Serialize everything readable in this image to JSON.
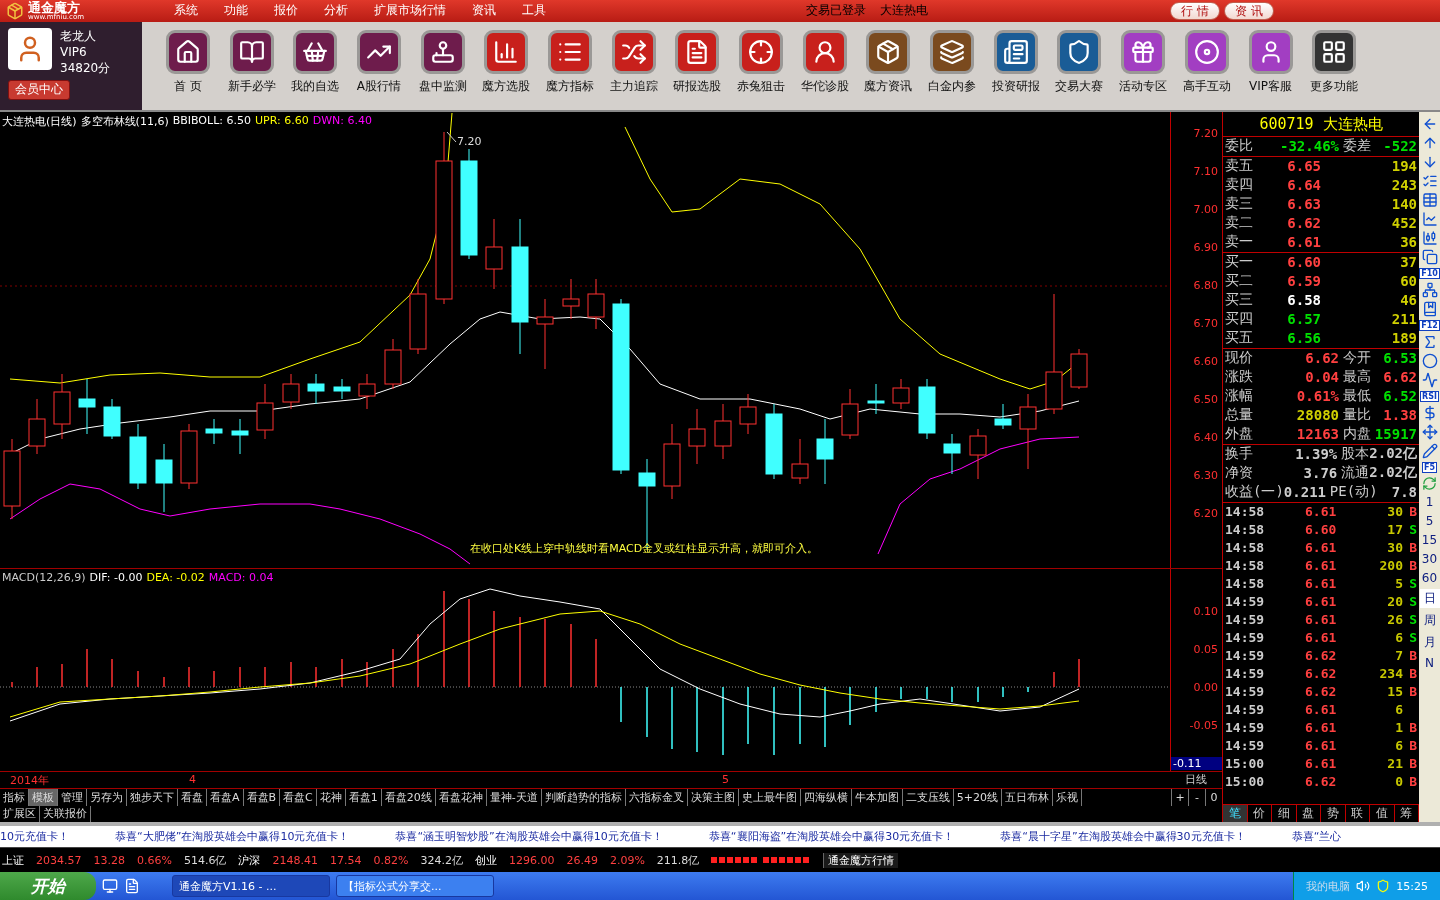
{
  "titlebar": {
    "logo": "通金魔方",
    "logo_url": "www.mfniu.com",
    "menu": [
      "系统",
      "功能",
      "报价",
      "分析",
      "扩展市场行情",
      "资讯",
      "工具"
    ],
    "login_status": "交易已登录",
    "stock": "大连热电",
    "tabs": [
      {
        "label": "行 情"
      },
      {
        "label": "资 讯"
      }
    ]
  },
  "user": {
    "name": "老龙人",
    "level": "VIP6",
    "points": "34820分",
    "button": "会员中心"
  },
  "toolbar": [
    {
      "label": "首 页",
      "color": "#6e1c4c"
    },
    {
      "label": "新手必学",
      "color": "#6e1c4c"
    },
    {
      "label": "我的自选",
      "color": "#6e1c4c"
    },
    {
      "label": "A股行情",
      "color": "#6e1c4c"
    },
    {
      "label": "盘中监测",
      "color": "#6e1c4c"
    },
    {
      "label": "魔方选股",
      "color": "#c8201c"
    },
    {
      "label": "魔方指标",
      "color": "#c8201c"
    },
    {
      "label": "主力追踪",
      "color": "#c8201c"
    },
    {
      "label": "研报选股",
      "color": "#c8201c"
    },
    {
      "label": "赤兔狙击",
      "color": "#c8201c"
    },
    {
      "label": "华佗诊股",
      "color": "#c8201c"
    },
    {
      "label": "魔方资讯",
      "color": "#7a4a1e"
    },
    {
      "label": "白金内参",
      "color": "#7a4a1e"
    },
    {
      "label": "投资研报",
      "color": "#1a5c96"
    },
    {
      "label": "交易大赛",
      "color": "#1a5c96"
    },
    {
      "label": "活动专区",
      "color": "#a23ec2"
    },
    {
      "label": "高手互动",
      "color": "#a23ec2"
    },
    {
      "label": "VIP客服",
      "color": "#a23ec2"
    },
    {
      "label": "更多功能",
      "color": "#333333"
    }
  ],
  "chart": {
    "title": "大连热电(日线)",
    "indicator": "多空布林线(11,6)",
    "values": [
      {
        "label": "BBIBOLL: 6.50",
        "color": "#ffffff"
      },
      {
        "label": "UPR: 6.60",
        "color": "#ffff00"
      },
      {
        "label": "DWN: 6.40",
        "color": "#ff00ff"
      }
    ],
    "peak_label": "7.20",
    "note": "在收口处K线上穿中轨线时看MACD金叉或红柱显示升高，就即可介入。",
    "price_ticks": [
      "7.20",
      "7.10",
      "7.00",
      "6.90",
      "6.80",
      "6.70",
      "6.60",
      "6.50",
      "6.40",
      "6.30",
      "6.20"
    ]
  },
  "macd": {
    "title": "MACD(12,26,9)",
    "values": [
      {
        "label": "DIF: -0.00",
        "color": "#ffffff"
      },
      {
        "label": "DEA: -0.02",
        "color": "#ffff00"
      },
      {
        "label": "MACD: 0.04",
        "color": "#ff00ff"
      }
    ],
    "ticks": [
      "0.10",
      "0.05",
      "0.00",
      "-0.05"
    ],
    "cursor_value": "-0.11"
  },
  "time_axis": {
    "year": "2014年",
    "months": [
      "4",
      "5"
    ],
    "period": "日线",
    "zoom_buttons": [
      "+",
      "-",
      "0"
    ]
  },
  "formula_tabs": [
    {
      "label": "指标",
      "selected": false
    },
    {
      "label": "模板",
      "selected": true
    },
    {
      "label": "管理",
      "selected": false
    },
    {
      "label": "另存为",
      "selected": false
    },
    {
      "label": "独步天下",
      "selected": false
    },
    {
      "label": "看盘",
      "selected": false
    },
    {
      "label": "看盘A",
      "selected": false
    },
    {
      "label": "看盘B",
      "selected": false
    },
    {
      "label": "看盘C",
      "selected": false
    },
    {
      "label": "花神",
      "selected": false
    },
    {
      "label": "看盘1",
      "selected": false
    },
    {
      "label": "看盘20线",
      "selected": false
    },
    {
      "label": "看盘花神",
      "selected": false
    },
    {
      "label": "量神-天道",
      "selected": false
    },
    {
      "label": "判断趋势的指标",
      "selected": false
    },
    {
      "label": "六指标金叉",
      "selected": false
    },
    {
      "label": "决策主图",
      "selected": false
    },
    {
      "label": "史上最牛图",
      "selected": false
    },
    {
      "label": "四海纵横",
      "selected": false
    },
    {
      "label": "牛本加图",
      "selected": false
    },
    {
      "label": "二支压线",
      "selected": false
    },
    {
      "label": "5+20线",
      "selected": false
    },
    {
      "label": "五日布林",
      "selected": false
    },
    {
      "label": "乐视",
      "selected": false
    }
  ],
  "extra_tabs": [
    "扩展区",
    "关联报价"
  ],
  "quote": {
    "title": "600719 大连热电",
    "ratio": [
      {
        "label": "委比",
        "value": "-32.46%"
      },
      {
        "label": "委差",
        "value": "-522"
      }
    ],
    "asks": [
      {
        "label": "卖五",
        "price": "6.65",
        "volume": "194",
        "color": "#ff4040"
      },
      {
        "label": "卖四",
        "price": "6.64",
        "volume": "243",
        "color": "#ff4040"
      },
      {
        "label": "卖三",
        "price": "6.63",
        "volume": "140",
        "color": "#ff4040"
      },
      {
        "label": "卖二",
        "price": "6.62",
        "volume": "452",
        "color": "#ff4040"
      },
      {
        "label": "卖一",
        "price": "6.61",
        "volume": "36",
        "color": "#ff4040"
      }
    ],
    "bids": [
      {
        "label": "买一",
        "price": "6.60",
        "volume": "37",
        "color": "#ff4040"
      },
      {
        "label": "买二",
        "price": "6.59",
        "volume": "60",
        "color": "#ff4040"
      },
      {
        "label": "买三",
        "price": "6.58",
        "volume": "46",
        "color": "#ffffff"
      },
      {
        "label": "买四",
        "price": "6.57",
        "volume": "211",
        "color": "#00e000"
      },
      {
        "label": "买五",
        "price": "6.56",
        "volume": "189",
        "color": "#00e000"
      }
    ],
    "stats": [
      [
        {
          "label": "现价",
          "value": "6.62",
          "color": "#ff4040"
        },
        {
          "label": "今开",
          "value": "6.53",
          "color": "#00e000"
        }
      ],
      [
        {
          "label": "涨跌",
          "value": "0.04",
          "color": "#ff4040"
        },
        {
          "label": "最高",
          "value": "6.62",
          "color": "#ff4040"
        }
      ],
      [
        {
          "label": "涨幅",
          "value": "0.61%",
          "color": "#ff4040"
        },
        {
          "label": "最低",
          "value": "6.52",
          "color": "#00e000"
        }
      ],
      [
        {
          "label": "总量",
          "value": "28080",
          "color": "#d0d000"
        },
        {
          "label": "量比",
          "value": "1.38",
          "color": "#ff4040"
        }
      ],
      [
        {
          "label": "外盘",
          "value": "12163",
          "color": "#ff4040"
        },
        {
          "label": "内盘",
          "value": "15917",
          "color": "#00e000"
        }
      ]
    ],
    "info": [
      [
        {
          "label": "换手",
          "value": "1.39%"
        },
        {
          "label": "股本",
          "value": "2.02亿"
        }
      ],
      [
        {
          "label": "净资",
          "value": "3.76"
        },
        {
          "label": "流通",
          "value": "2.02亿"
        }
      ],
      [
        {
          "label": "收益(一)",
          "value": "0.211"
        },
        {
          "label": "PE(动)",
          "value": "7.8"
        }
      ]
    ],
    "trades": [
      {
        "time": "14:58",
        "price": "6.61",
        "volume": "30",
        "side": "B",
        "color": "#ff4040"
      },
      {
        "time": "14:58",
        "price": "6.60",
        "volume": "17",
        "side": "S",
        "color": "#00e000"
      },
      {
        "time": "14:58",
        "price": "6.61",
        "volume": "30",
        "side": "B",
        "color": "#ff4040"
      },
      {
        "time": "14:58",
        "price": "6.61",
        "volume": "200",
        "side": "B",
        "color": "#ff4040"
      },
      {
        "time": "14:58",
        "price": "6.61",
        "volume": "5",
        "side": "S",
        "color": "#00e000"
      },
      {
        "time": "14:59",
        "price": "6.61",
        "volume": "20",
        "side": "S",
        "color": "#00e000"
      },
      {
        "time": "14:59",
        "price": "6.61",
        "volume": "26",
        "side": "S",
        "color": "#00e000"
      },
      {
        "time": "14:59",
        "price": "6.61",
        "volume": "6",
        "side": "S",
        "color": "#00e000"
      },
      {
        "time": "14:59",
        "price": "6.62",
        "volume": "7",
        "side": "B",
        "color": "#ff4040"
      },
      {
        "time": "14:59",
        "price": "6.62",
        "volume": "234",
        "side": "B",
        "color": "#ff4040"
      },
      {
        "time": "14:59",
        "price": "6.62",
        "volume": "15",
        "side": "B",
        "color": "#ff4040"
      },
      {
        "time": "14:59",
        "price": "6.61",
        "volume": "6"
      },
      {
        "time": "14:59",
        "price": "6.61",
        "volume": "1",
        "side": "B",
        "color": "#ff4040"
      },
      {
        "time": "14:59",
        "price": "6.61",
        "volume": "6",
        "side": "B",
        "color": "#ff4040"
      },
      {
        "time": "15:00",
        "price": "6.61",
        "volume": "21",
        "side": "B",
        "color": "#ff4040"
      },
      {
        "time": "15:00",
        "price": "6.62",
        "volume": "0",
        "side": "B",
        "color": "#ff4040"
      }
    ],
    "detail_tabs": [
      {
        "label": "笔",
        "selected": true
      },
      {
        "label": "价",
        "selected": false
      },
      {
        "label": "细",
        "selected": false
      },
      {
        "label": "盘",
        "selected": false
      },
      {
        "label": "势",
        "selected": false
      },
      {
        "label": "联",
        "selected": false
      },
      {
        "label": "值",
        "selected": false
      },
      {
        "label": "筹",
        "selected": false
      }
    ]
  },
  "tool_strip": {
    "labels": [
      "F10",
      "F12",
      "RSI",
      "F5"
    ],
    "periods": [
      {
        "label": "1",
        "selected": false
      },
      {
        "label": "5",
        "selected": false
      },
      {
        "label": "15",
        "selected": false
      },
      {
        "label": "30",
        "selected": false
      },
      {
        "label": "60",
        "selected": false
      },
      {
        "label": "日",
        "selected": true
      },
      {
        "label": "周",
        "selected": false
      },
      {
        "label": "月",
        "selected": false
      },
      {
        "label": "N",
        "selected": false
      }
    ]
  },
  "ticker": [
    "10元充值卡！",
    "恭喜“大肥佬”在淘股英雄会中赢得10元充值卡！",
    "恭喜“涵玉明智炒股”在淘股英雄会中赢得10元充值卡！",
    "恭喜“襄阳海盗”在淘股英雄会中赢得30元充值卡！",
    "恭喜“晨十字星”在淘股英雄会中赢得30元充值卡！",
    "恭喜“兰心"
  ],
  "status_bar": {
    "indexes": [
      {
        "name": "上证",
        "value": "2034.57",
        "change": "13.28",
        "pct": "0.66%",
        "amount": "514.6亿"
      },
      {
        "name": "沪深",
        "value": "2148.41",
        "change": "17.54",
        "pct": "0.82%",
        "amount": "324.2亿"
      },
      {
        "name": "创业",
        "value": "1296.00",
        "change": "26.49",
        "pct": "2.09%",
        "amount": "211.8亿"
      }
    ],
    "feed": "通金魔方行情"
  },
  "taskbar": {
    "start": "开始",
    "windows": [
      {
        "label": "通金魔方V1.16 - ...",
        "selected": true
      },
      {
        "label": "【指标公式分享交...",
        "selected": false
      }
    ],
    "tray_label": "我的电脑",
    "clock": "15:25"
  }
}
